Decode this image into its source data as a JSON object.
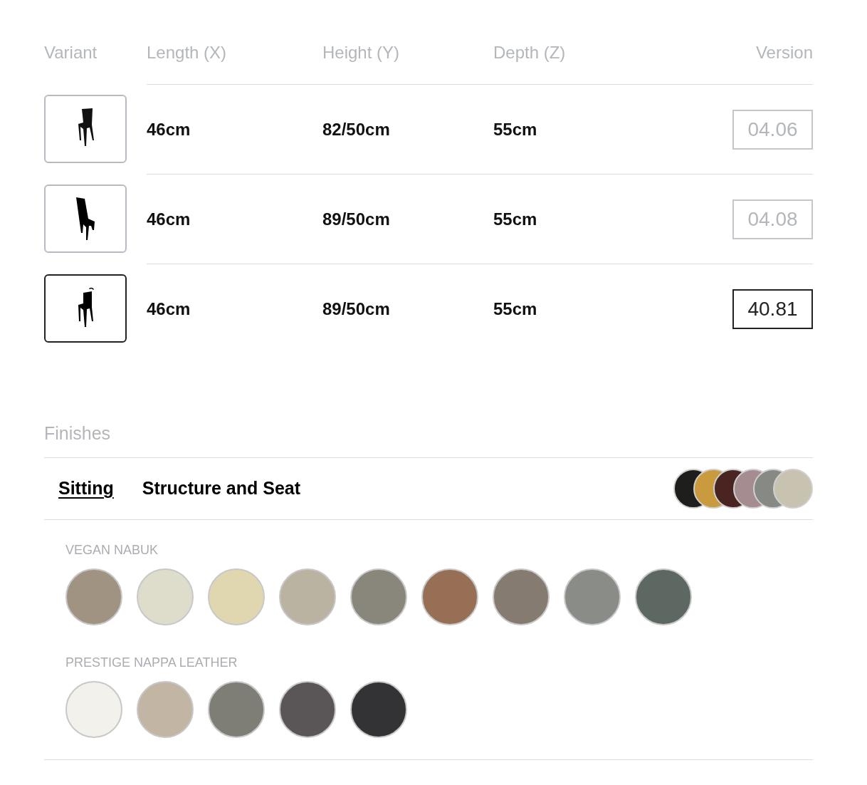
{
  "table": {
    "columns": [
      "Variant",
      "Length (X)",
      "Height (Y)",
      "Depth (Z)",
      "Version"
    ],
    "rows": [
      {
        "kind": "standard",
        "length": "46cm",
        "height": "82/50cm",
        "depth": "55cm",
        "version": "04.06",
        "selected": false
      },
      {
        "kind": "high-back",
        "length": "46cm",
        "height": "89/50cm",
        "depth": "55cm",
        "version": "04.08",
        "selected": false
      },
      {
        "kind": "handle",
        "length": "46cm",
        "height": "89/50cm",
        "depth": "55cm",
        "version": "40.81",
        "selected": true
      }
    ]
  },
  "finishes": {
    "title": "Finishes",
    "tabs": [
      {
        "label": "Sitting",
        "selected": true
      },
      {
        "label": "Structure and Seat",
        "selected": false
      }
    ],
    "preview": [
      {
        "color": "#1e1e1c"
      },
      {
        "color": "#c99a3e"
      },
      {
        "color": "#4a2420"
      },
      {
        "color": "#a48c90"
      },
      {
        "color": "#878985"
      },
      {
        "color": "#c8c2b0"
      }
    ],
    "groups": [
      {
        "name": "VEGAN NABUK",
        "swatches": [
          {
            "color": "#a09382"
          },
          {
            "color": "#dedccb"
          },
          {
            "color": "#e0d6b0"
          },
          {
            "color": "#bab3a1"
          },
          {
            "color": "#89867c"
          },
          {
            "color": "#976f55"
          },
          {
            "color": "#857b70"
          },
          {
            "color": "#8a8c88"
          },
          {
            "color": "#5d6862"
          }
        ]
      },
      {
        "name": "PRESTIGE NAPPA LEATHER",
        "swatches": [
          {
            "color": "#f3f1ec"
          },
          {
            "color": "#c2b5a3"
          },
          {
            "color": "#7f7e76"
          },
          {
            "color": "#5a5658"
          },
          {
            "color": "#333335"
          }
        ]
      }
    ]
  }
}
